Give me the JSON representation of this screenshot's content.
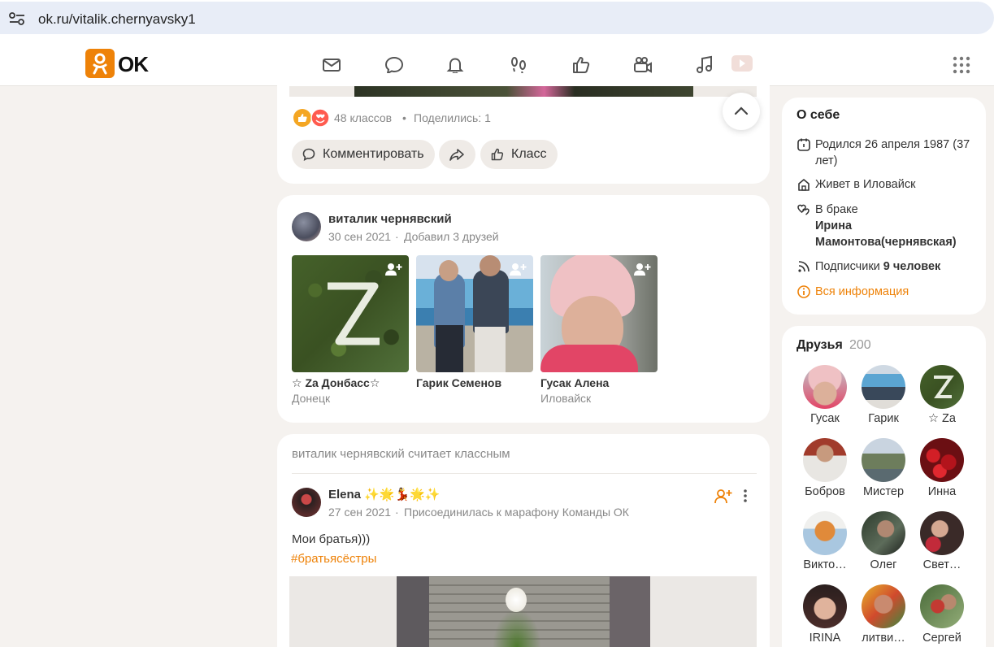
{
  "browser": {
    "url": "ok.ru/vitalik.chernyavsky1"
  },
  "header": {
    "logo_text": "OK",
    "nav_icons": [
      "mail-icon",
      "chat-icon",
      "bell-icon",
      "footprints-icon",
      "thumbs-up-icon",
      "video-camera-icon",
      "music-icon",
      "video-play-icon"
    ]
  },
  "post1": {
    "reactions_count": "48 классов",
    "shares": "Поделились: 1",
    "comment_label": "Комментировать",
    "like_label": "Класс"
  },
  "post2": {
    "author": "виталик чернявский",
    "date": "30 сен 2021",
    "action": "Добавил 3 друзей",
    "friends": [
      {
        "name": "☆ Za Донбасс☆",
        "city": "Донецк"
      },
      {
        "name": "Гарик Семенов",
        "city": ""
      },
      {
        "name": "Гусак Алена",
        "city": "Иловайск"
      }
    ]
  },
  "post3": {
    "header": "виталик чернявский считает классным",
    "author": "Elena ✨🌟💃🌟✨",
    "date": "27 сен 2021",
    "action": "Присоединилась к марафону Команды ОК",
    "text": "Мои братья)))",
    "hashtag": "#братьясёстры"
  },
  "about": {
    "title": "О себе",
    "born": "Родился 26 апреля 1987 (37 лет)",
    "lives": "Живет в Иловайск",
    "married_label": "В браке",
    "spouse": "Ирина Мамонтова(чернявская)",
    "subscribers_label": "Подписчики",
    "subscribers_count": "9 человек",
    "all_info": "Вся информация"
  },
  "friends": {
    "title": "Друзья",
    "count": "200",
    "items": [
      "Гусак",
      "Гарик",
      "☆ Za",
      "Бобров",
      "Мистер",
      "Инна",
      "Викто…",
      "Олег",
      "Свет…",
      "IRINA",
      "литви…",
      "Сергей"
    ]
  },
  "colors": {
    "accent": "#ee8208",
    "page_bg": "#f5f2ef"
  }
}
